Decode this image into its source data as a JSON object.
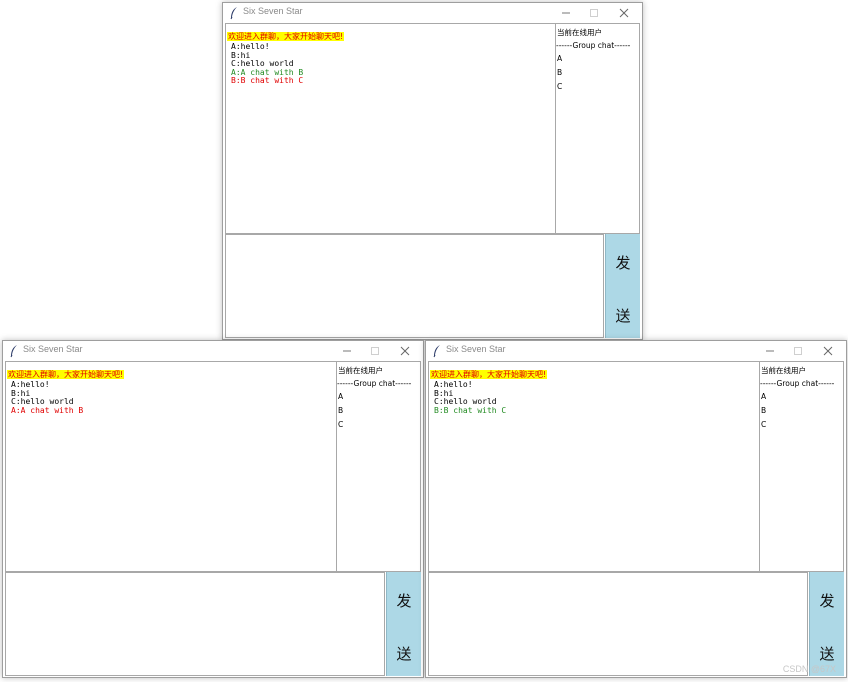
{
  "windows": [
    {
      "title": "Six Seven Star",
      "welcome": "欢迎进入群聊，大家开始聊天吧!",
      "messages": [
        {
          "text": "A:hello!",
          "color": "black"
        },
        {
          "text": "B:hi",
          "color": "black"
        },
        {
          "text": "C:hello world",
          "color": "black"
        },
        {
          "text": "A:A chat with B",
          "color": "green"
        },
        {
          "text": "B:B chat with C",
          "color": "red"
        }
      ],
      "user_list_title": "当前在线用户",
      "group_label": "------Group chat------",
      "users": [
        "A",
        "B",
        "C"
      ],
      "send_char_1": "发",
      "send_char_2": "送"
    },
    {
      "title": "Six Seven Star",
      "welcome": "欢迎进入群聊，大家开始聊天吧!",
      "messages": [
        {
          "text": "A:hello!",
          "color": "black"
        },
        {
          "text": "B:hi",
          "color": "black"
        },
        {
          "text": "C:hello world",
          "color": "black"
        },
        {
          "text": "A:A chat with B",
          "color": "red"
        }
      ],
      "user_list_title": "当前在线用户",
      "group_label": "------Group chat------",
      "users": [
        "A",
        "B",
        "C"
      ],
      "send_char_1": "发",
      "send_char_2": "送"
    },
    {
      "title": "Six Seven Star",
      "welcome": "欢迎进入群聊，大家开始聊天吧!",
      "messages": [
        {
          "text": "A:hello!",
          "color": "black"
        },
        {
          "text": "B:hi",
          "color": "black"
        },
        {
          "text": "C:hello world",
          "color": "black"
        },
        {
          "text": "B:B chat with C",
          "color": "green"
        }
      ],
      "user_list_title": "当前在线用户",
      "group_label": "------Group chat------",
      "users": [
        "A",
        "B",
        "C"
      ],
      "send_char_1": "发",
      "send_char_2": "送"
    }
  ],
  "colors": {
    "welcome_bg": "#ffff00",
    "welcome_fg": "#e00000",
    "send_bg": "#add8e6",
    "msg_green": "#228b22",
    "msg_red": "#e00000"
  },
  "watermark": "CSDN @67X"
}
